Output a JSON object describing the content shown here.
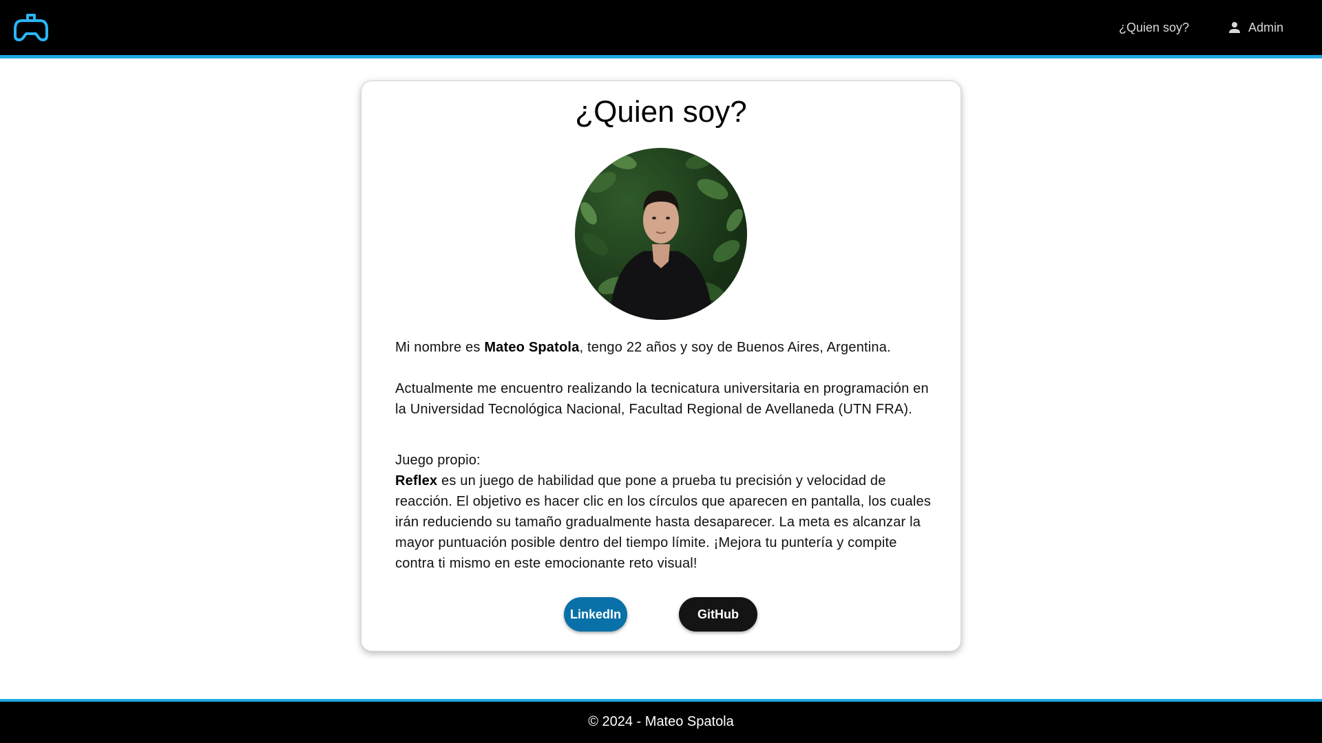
{
  "header": {
    "nav": {
      "about_label": "¿Quien soy?",
      "admin_label": "Admin"
    },
    "accent_color": "#1fa8e0"
  },
  "card": {
    "title": "¿Quien soy?",
    "intro": {
      "prefix": "Mi nombre es ",
      "name": "Mateo Spatola",
      "suffix": ", tengo 22 años y soy de Buenos Aires, Argentina."
    },
    "studies": "Actualmente me encuentro realizando la tecnicatura universitaria en programación en la Universidad Tecnológica Nacional, Facultad Regional de Avellaneda (UTN FRA).",
    "game": {
      "heading": "Juego propio:",
      "name": "Reflex",
      "description": " es un juego de habilidad que pone a prueba tu precisión y velocidad de reacción. El objetivo es hacer clic en los círculos que aparecen en pantalla, los cuales irán reduciendo su tamaño gradualmente hasta desaparecer. La meta es alcanzar la mayor puntuación posible dentro del tiempo límite. ¡Mejora tu puntería y compite contra ti mismo en este emocionante reto visual!"
    },
    "buttons": {
      "linkedin_label": "LinkedIn",
      "github_label": "GitHub",
      "linkedin_color": "#0a71a8",
      "github_color": "#141414"
    }
  },
  "footer": {
    "text": "© 2024 - Mateo Spatola"
  }
}
